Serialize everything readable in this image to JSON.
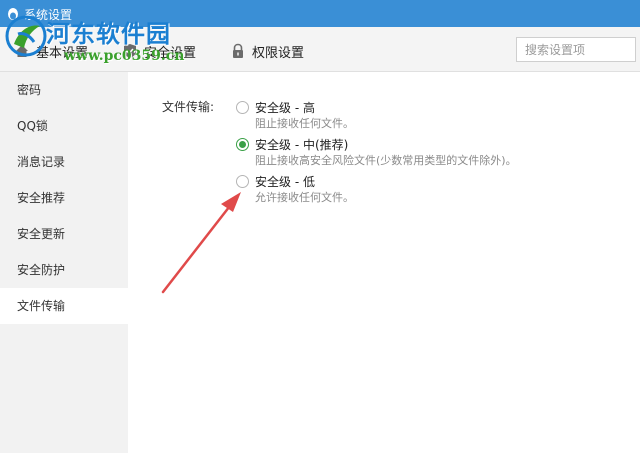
{
  "window": {
    "title": "系统设置"
  },
  "watermark": {
    "brand": "河东软件园",
    "url": "www.pc0359.cn"
  },
  "tabs": [
    {
      "label": "基本设置",
      "icon": "home-icon"
    },
    {
      "label": "安全设置",
      "icon": "shield-icon"
    },
    {
      "label": "权限设置",
      "icon": "lock-icon"
    }
  ],
  "search": {
    "placeholder": "搜索设置项",
    "value": ""
  },
  "sidebar": {
    "items": [
      {
        "label": "密码"
      },
      {
        "label": "QQ锁"
      },
      {
        "label": "消息记录"
      },
      {
        "label": "安全推荐"
      },
      {
        "label": "安全更新"
      },
      {
        "label": "安全防护"
      },
      {
        "label": "文件传输"
      }
    ],
    "active": "文件传输"
  },
  "file_transfer": {
    "label": "文件传输:",
    "options": [
      {
        "title": "安全级 - 高",
        "desc": "阻止接收任何文件。",
        "selected": false
      },
      {
        "title": "安全级 - 中(推荐)",
        "desc": "阻止接收高安全风险文件(少数常用类型的文件除外)。",
        "selected": true
      },
      {
        "title": "安全级 - 低",
        "desc": "允许接收任何文件。",
        "selected": false
      }
    ]
  },
  "colors": {
    "titlebar": "#3a8fd6",
    "radio_selected": "#3aa047",
    "arrow": "#e04a4a",
    "watermark_brand": "#1b7fd1",
    "watermark_url": "#3aa02c"
  }
}
